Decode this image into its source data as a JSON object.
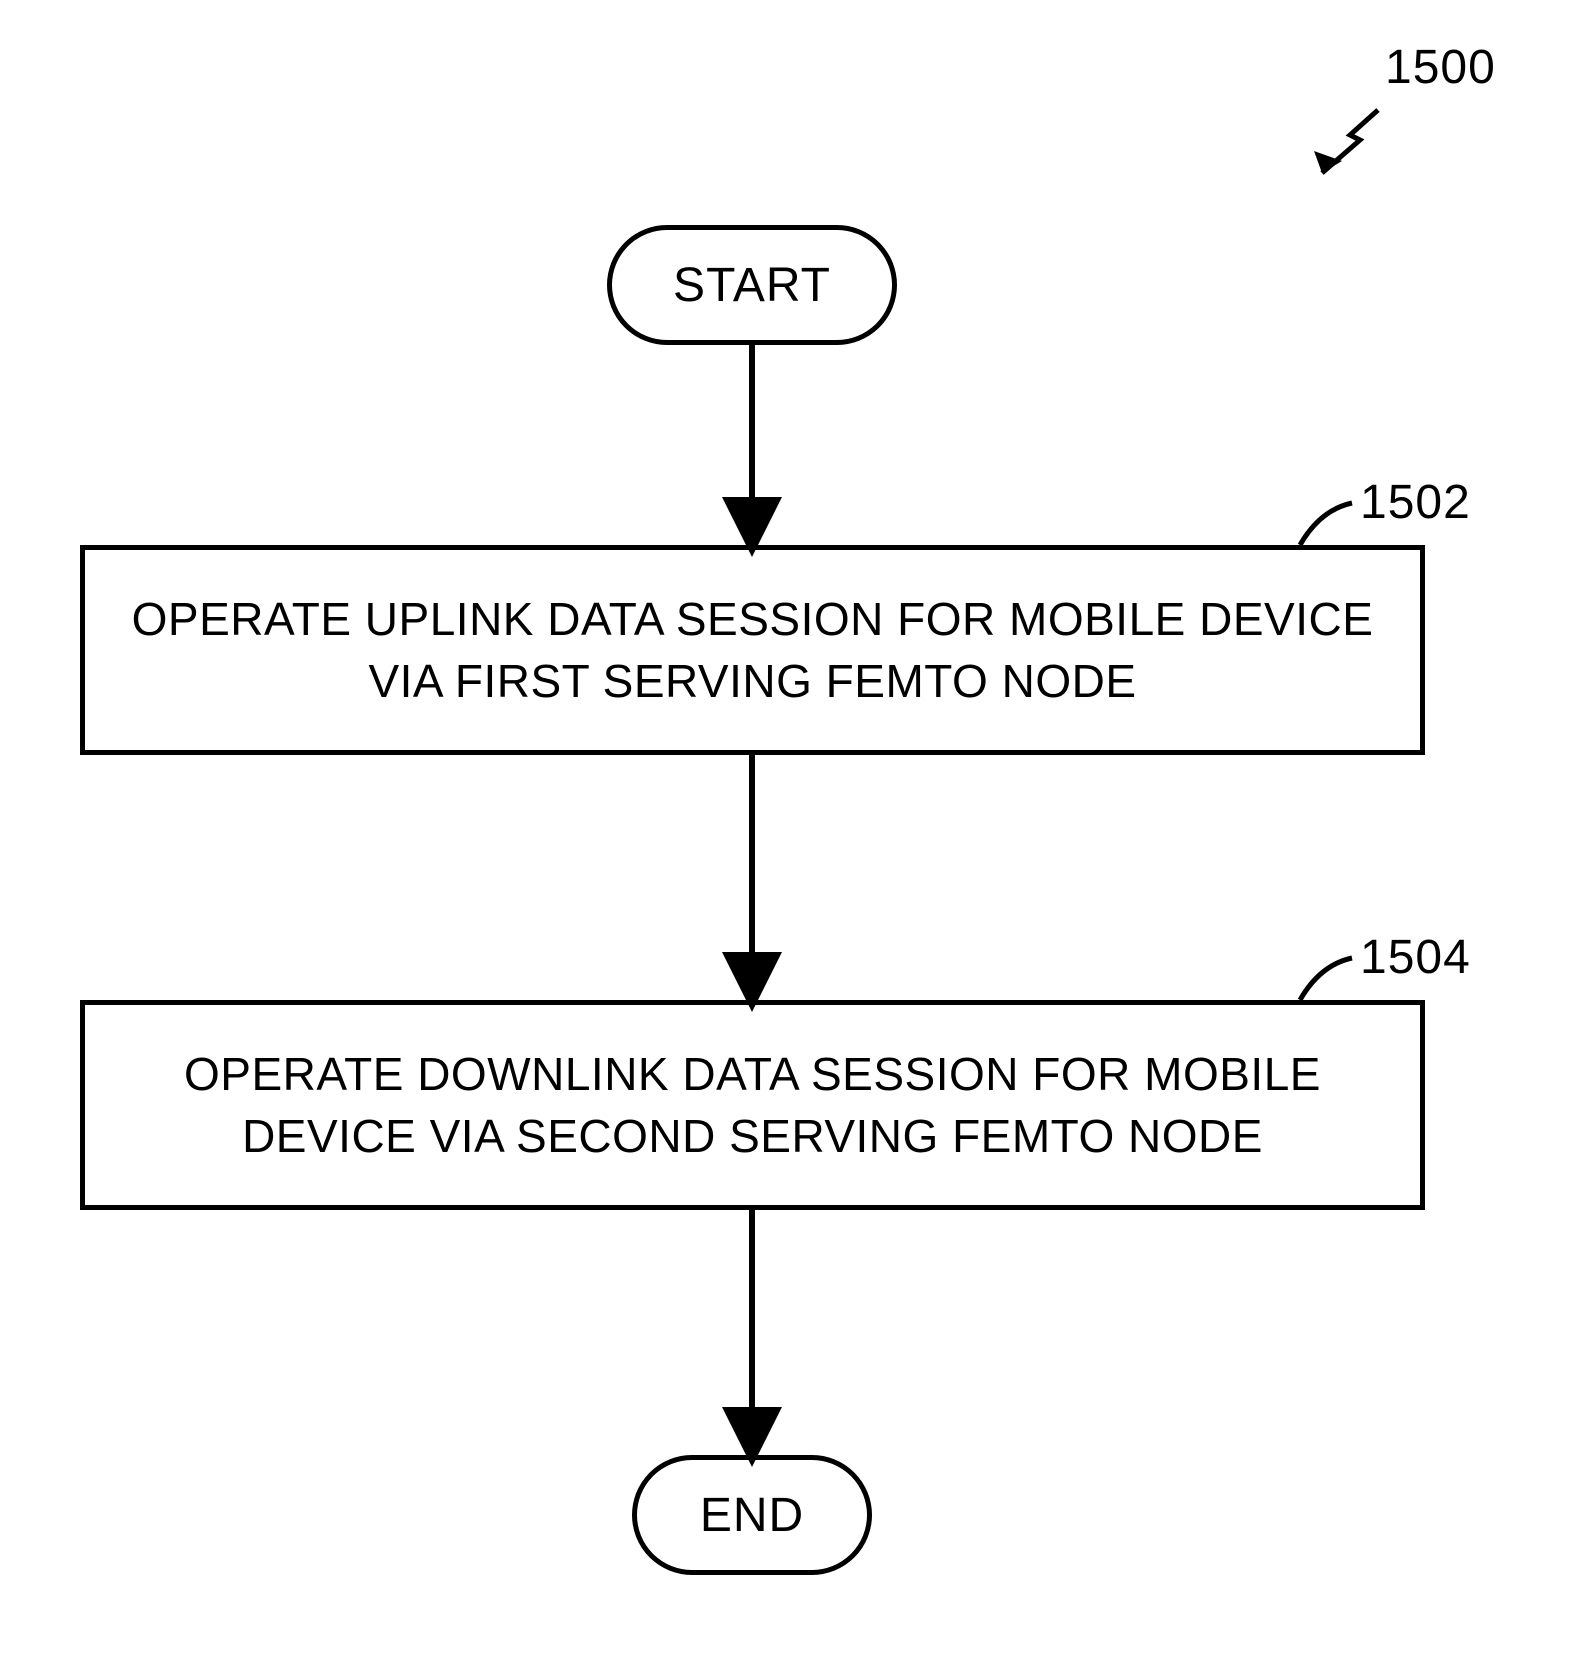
{
  "diagram": {
    "id_label": "1500",
    "start_label": "START",
    "end_label": "END",
    "steps": [
      {
        "ref": "1502",
        "text": "OPERATE UPLINK DATA SESSION FOR MOBILE DEVICE VIA FIRST SERVING FEMTO NODE"
      },
      {
        "ref": "1504",
        "text": "OPERATE DOWNLINK DATA SESSION FOR MOBILE DEVICE VIA SECOND SERVING FEMTO NODE"
      }
    ]
  },
  "chart_data": {
    "type": "flowchart",
    "nodes": [
      {
        "id": "start",
        "kind": "terminator",
        "label": "START"
      },
      {
        "id": "1502",
        "kind": "process",
        "label": "OPERATE UPLINK DATA SESSION FOR MOBILE DEVICE VIA FIRST SERVING FEMTO NODE"
      },
      {
        "id": "1504",
        "kind": "process",
        "label": "OPERATE DOWNLINK DATA SESSION FOR MOBILE DEVICE VIA SECOND SERVING FEMTO NODE"
      },
      {
        "id": "end",
        "kind": "terminator",
        "label": "END"
      }
    ],
    "edges": [
      {
        "from": "start",
        "to": "1502"
      },
      {
        "from": "1502",
        "to": "1504"
      },
      {
        "from": "1504",
        "to": "end"
      }
    ],
    "diagram_ref": "1500"
  }
}
